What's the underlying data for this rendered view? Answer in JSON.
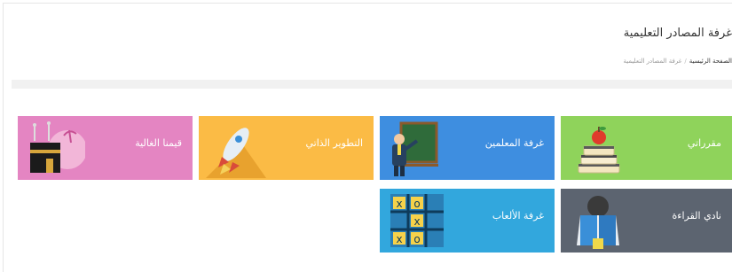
{
  "header": {
    "title": "غرفة المصادر التعليمية",
    "breadcrumb": {
      "home": "الصفحة الرئيسية",
      "separator": "/",
      "current": "غرفة المصادر التعليمية"
    }
  },
  "tiles": [
    {
      "label": "مقرراتي",
      "color": "#8fd35b",
      "icon": "books-apple-icon"
    },
    {
      "label": "غرفة المعلمين",
      "color": "#3e8ee0",
      "icon": "teacher-board-icon"
    },
    {
      "label": "التطوير الذاتي",
      "color": "#fbbb45",
      "icon": "rocket-icon"
    },
    {
      "label": "قيمنا الغالية",
      "color": "#e485c2",
      "icon": "kaaba-icon"
    },
    {
      "label": "نادي القراءة",
      "color": "#5c6470",
      "icon": "reader-icon"
    },
    {
      "label": "غرفة الألعاب",
      "color": "#32a7dd",
      "icon": "tic-tac-toe-icon"
    }
  ]
}
